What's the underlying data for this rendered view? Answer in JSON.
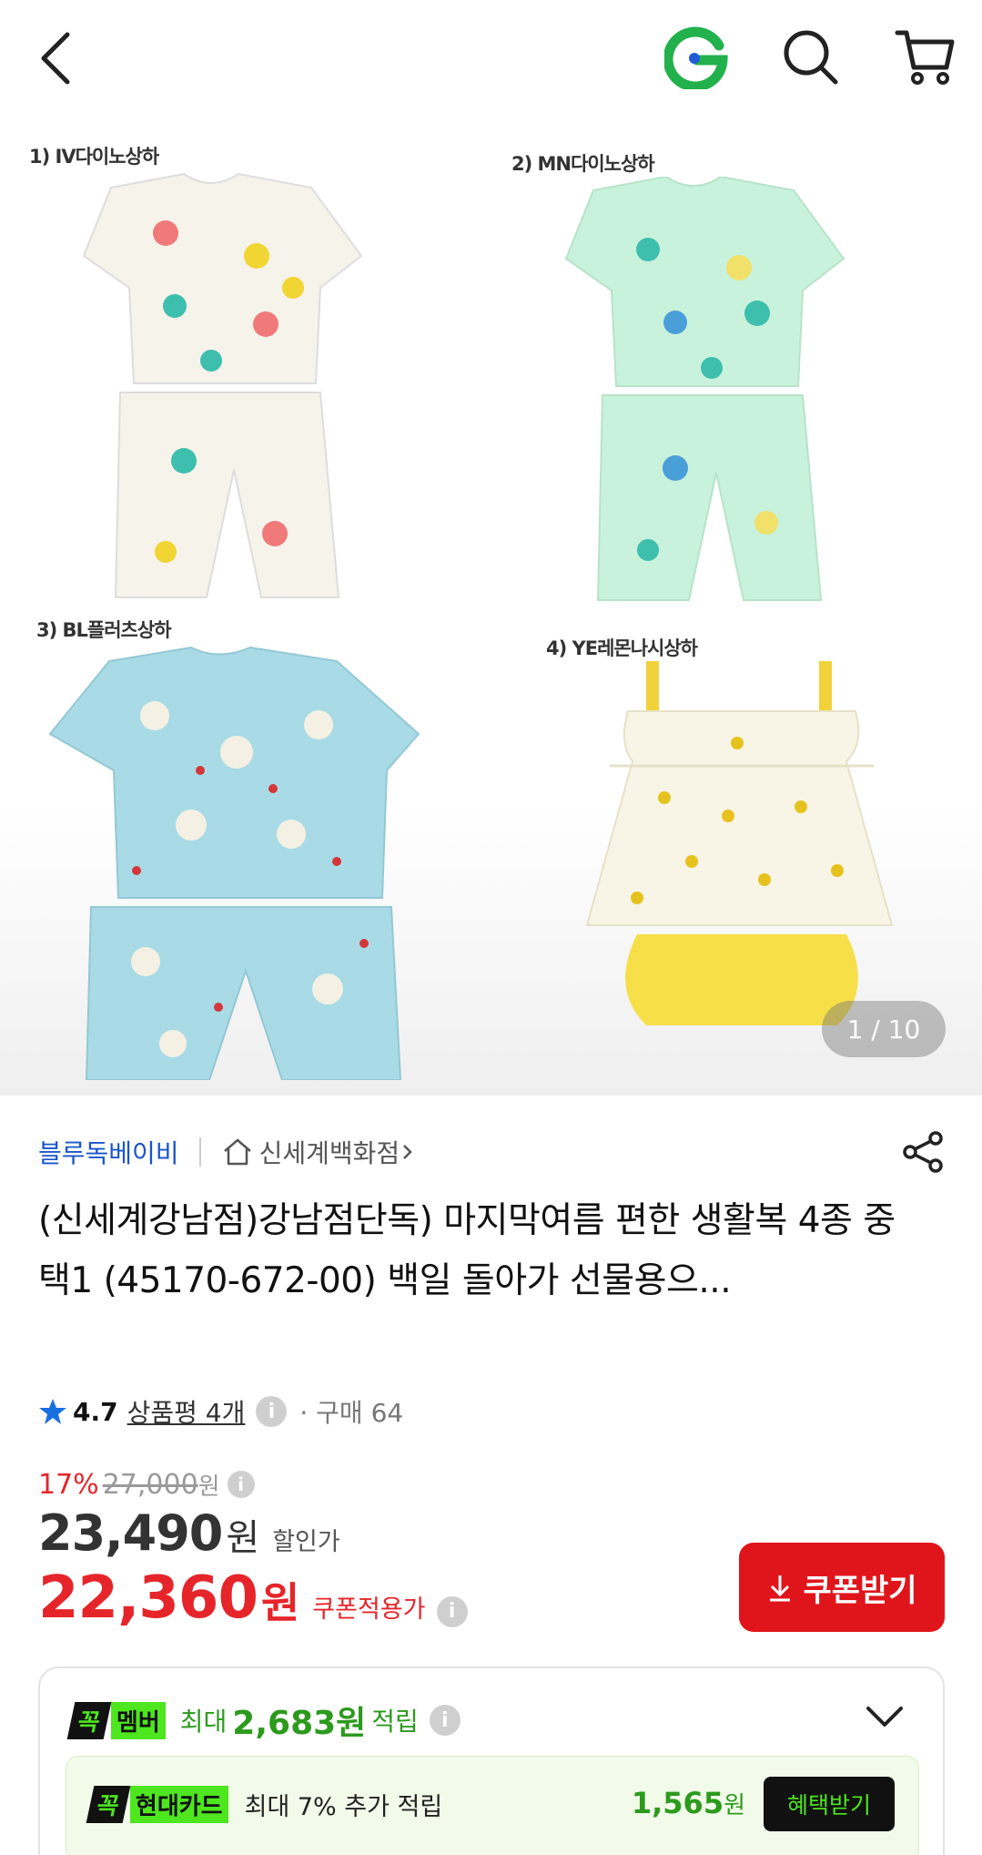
{
  "header": {
    "back_icon": "chevron-left-icon",
    "logo_icon": "g-logo-icon",
    "search_icon": "search-icon",
    "cart_icon": "cart-icon"
  },
  "gallery": {
    "items": [
      {
        "tag": "1) IV다이노상하"
      },
      {
        "tag": "2) MN다이노상하"
      },
      {
        "tag": "3) BL플러츠상하"
      },
      {
        "tag": "4) YE레몬나시상하"
      }
    ],
    "counter": "1 / 10"
  },
  "product": {
    "brand": "블루독베이비",
    "store": "신세계백화점",
    "title": "(신세계강남점)강남점단독) 마지막여름 편한 생활복 4종 중 택1 (45170-672-00) 백일 돌아가 선물용으...",
    "rating": "4.7",
    "reviews": "상품평 4개",
    "purchases": "· 구매 64"
  },
  "price": {
    "discount_pct": "17%",
    "original": "27,000",
    "original_unit": "원",
    "sale": "23,490",
    "sale_unit": "원",
    "sale_label": "할인가",
    "coupon": "22,360",
    "coupon_unit": "원",
    "coupon_label": "쿠폰적용가",
    "coupon_button": "쿠폰받기"
  },
  "benefit": {
    "member_k": "꼭",
    "member_label": "멤버",
    "max_label": "최대",
    "amount": "2,683원",
    "earn": "적립",
    "card_k": "꼭",
    "card_name": "현대카드",
    "card_desc": "최대 7% 추가 적립",
    "card_amount": "1,565",
    "card_unit": "원",
    "card_button": "혜택받기"
  },
  "colors": {
    "accent_red": "#e0151c",
    "brand_blue": "#1a55c9",
    "kkok_green": "#4de61f"
  }
}
